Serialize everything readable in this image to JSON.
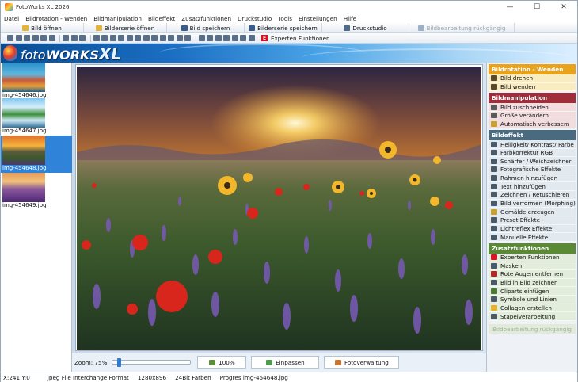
{
  "window": {
    "title": "FotoWorks XL 2026",
    "controls": {
      "minimize": "—",
      "maximize": "☐",
      "close": "✕"
    }
  },
  "menu": [
    "Datei",
    "Bildrotation - Wenden",
    "Bildmanipulation",
    "Bildeffekt",
    "Zusatzfunktionen",
    "Druckstudio",
    "Tools",
    "Einstellungen",
    "Hilfe"
  ],
  "toolbar_main": [
    {
      "label": "Bild öffnen",
      "icon": "folder-icon",
      "color": "#e3b43c"
    },
    {
      "label": "Bilderserie öffnen",
      "icon": "folder-stack-icon",
      "color": "#e3b43c"
    },
    {
      "label": "Bild speichern",
      "icon": "save-icon",
      "color": "#3a5c8a"
    },
    {
      "label": "Bilderserie speichern",
      "icon": "save-stack-icon",
      "color": "#3a5c8a"
    },
    {
      "label": "Druckstudio",
      "icon": "printer-icon",
      "color": "#4f6b85"
    },
    {
      "label": "Bildbearbeitung rückgängig",
      "icon": "undo-icon",
      "color": "#9db0c5"
    }
  ],
  "toolbar_icons_color": "#5a6e87",
  "experten_button": {
    "label": "Experten Funktionen",
    "icon": "E"
  },
  "logo": {
    "part1": "foto",
    "part2": "WORKS",
    "part3": "XL"
  },
  "thumbnails": [
    {
      "caption": "img-454646.jpg",
      "selected": false
    },
    {
      "caption": "img-454647.jpg",
      "selected": false
    },
    {
      "caption": "img-454648.jpg",
      "selected": true
    },
    {
      "caption": "img-454649.jpg",
      "selected": false
    }
  ],
  "zoom": {
    "label": "Zoom: 75%",
    "slider_value": 0.06
  },
  "bottom_buttons": [
    {
      "label": "100%",
      "icon": "fullsize-icon",
      "color": "#5d8c3a"
    },
    {
      "label": "Einpassen",
      "icon": "fit-icon",
      "color": "#4f9a4f"
    },
    {
      "label": "Fotoverwaltung",
      "icon": "gallery-icon",
      "color": "#c9742c"
    }
  ],
  "panels": [
    {
      "title": "Bildrotation - Wenden",
      "head_color": "#e8a21b",
      "item_color": "#f8ecc0",
      "items": [
        {
          "label": "Bild drehen",
          "icon": "rotate-icon"
        },
        {
          "label": "Bild wenden",
          "icon": "flip-icon"
        }
      ]
    },
    {
      "title": "Bildmanipulation",
      "head_color": "#a02d3a",
      "item_color": "#f3dcde",
      "items": [
        {
          "label": "Bild zuschneiden",
          "icon": "crop-icon"
        },
        {
          "label": "Größe verändern",
          "icon": "resize-icon"
        },
        {
          "label": "Automatisch verbessern",
          "icon": "magic-icon"
        }
      ]
    },
    {
      "title": "Bildeffekt",
      "head_color": "#4a6a80",
      "item_color": "#e2e9ef",
      "items": [
        {
          "label": "Helligkeit/ Kontrast/ Farbe",
          "icon": "brightness-icon"
        },
        {
          "label": "Farbkorrektur RGB",
          "icon": "rgb-icon"
        },
        {
          "label": "Schärfer / Weichzeichner",
          "icon": "sharpen-icon"
        },
        {
          "label": "Fotografische Effekte",
          "icon": "camera-icon"
        },
        {
          "label": "Rahmen hinzufügen",
          "icon": "frame-icon"
        },
        {
          "label": "Text hinzufügen",
          "icon": "text-icon"
        },
        {
          "label": "Zeichnen / Retuschieren",
          "icon": "brush-icon"
        },
        {
          "label": "Bild verformen (Morphing)",
          "icon": "morph-icon"
        },
        {
          "label": "Gemälde erzeugen",
          "icon": "palette-icon"
        },
        {
          "label": "Preset Effekte",
          "icon": "preset-icon"
        },
        {
          "label": "Lichtreflex Effekte",
          "icon": "lensflare-icon"
        },
        {
          "label": "Manuelle Effekte",
          "icon": "manual-icon"
        }
      ]
    },
    {
      "title": "Zusatzfunktionen",
      "head_color": "#5b8a35",
      "item_color": "#e3eddb",
      "items": [
        {
          "label": "Experten Funktionen",
          "icon": "expert-icon"
        },
        {
          "label": "Masken",
          "icon": "mask-icon"
        },
        {
          "label": "Rote Augen entfernen",
          "icon": "redeye-icon"
        },
        {
          "label": "Bild in Bild zeichnen",
          "icon": "pip-icon"
        },
        {
          "label": "Cliparts einfügen",
          "icon": "clipart-icon"
        },
        {
          "label": "Symbole und Linien",
          "icon": "symbols-icon"
        },
        {
          "label": "Collagen erstellen",
          "icon": "collage-icon"
        },
        {
          "label": "Stapelverarbeitung",
          "icon": "batch-icon"
        }
      ]
    }
  ],
  "undo_disabled_label": "Bildbearbeitung rückgängig",
  "status": {
    "coords": "X:241 Y:0",
    "format": "Jpeg File Interchange Format",
    "size": "1280x896",
    "depth": "24Bit Farben",
    "file": "Progres img-454648.jpg"
  }
}
